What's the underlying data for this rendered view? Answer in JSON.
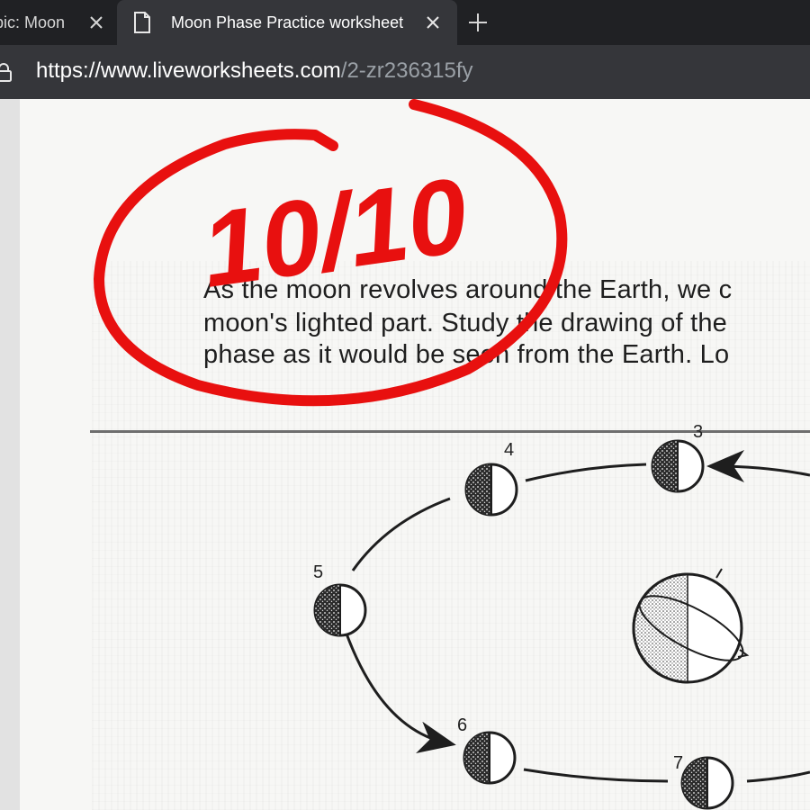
{
  "browser": {
    "tabs": [
      {
        "title": "pic: Moon",
        "active": false
      },
      {
        "title": "Moon Phase Practice worksheet",
        "active": true
      }
    ],
    "new_tab_icon": "plus-icon",
    "address": {
      "host": "https://www.liveworksheets.com",
      "path": "/2-zr236315fy"
    }
  },
  "worksheet": {
    "instructions": {
      "line1": "As the moon revolves around the Earth, we c",
      "line2": "moon's lighted part. Study the drawing of the",
      "line3": "phase as it would be seen from the Earth. Lo"
    },
    "diagram": {
      "phase_numbers": [
        "3",
        "4",
        "5",
        "6",
        "7"
      ],
      "center_body": "earth-icon"
    },
    "score": "10/10",
    "colors": {
      "score_stamp": "#e8100f",
      "chrome_dark": "#202124",
      "chrome_tab": "#35363a",
      "url_path": "#9aa0a6"
    }
  }
}
